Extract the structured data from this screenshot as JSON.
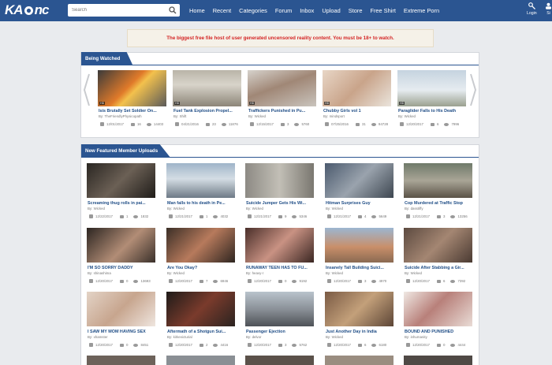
{
  "site": {
    "logo_left": "KA",
    "logo_right": "nc"
  },
  "search": {
    "placeholder": "Search"
  },
  "nav": [
    "Home",
    "Recent",
    "Categories",
    "Forum",
    "Inbox",
    "Upload",
    "Store",
    "Free Shirt",
    "Extreme Porn"
  ],
  "account": {
    "login_label": "Login",
    "signup_label": "Si"
  },
  "warning": "The biggest free file host of user generated uncensored reality content. You must be 18+ to watch.",
  "being_watched": {
    "heading": "Being Watched",
    "items": [
      {
        "title": "Isis Brutally Set Soldier On...",
        "by": "By: TheFriendlyPhysicopath",
        "date": "12/01/2017",
        "comments": "16",
        "views": "14403",
        "hd": "HD"
      },
      {
        "title": "Fuel Tank Explosion Propel...",
        "by": "By: Shift",
        "date": "04/21/2016",
        "comments": "23",
        "views": "11876",
        "hd": "HD"
      },
      {
        "title": "Traffickers Punished in Pu...",
        "by": "By: Wicked",
        "date": "12/15/2017",
        "comments": "3",
        "views": "5760",
        "hd": "HD"
      },
      {
        "title": "Chubby Girls vol 1",
        "by": "By: mindsport",
        "date": "07/25/2016",
        "comments": "31",
        "views": "94728",
        "hd": "HD"
      },
      {
        "title": "Paraglider Falls to His Death",
        "by": "By: Wicked",
        "date": "12/20/2017",
        "comments": "6",
        "views": "7996",
        "hd": "HD"
      }
    ]
  },
  "featured": {
    "heading": "New Featured Member Uploads",
    "items": [
      {
        "title": "Screaming thug rolls in pai...",
        "by": "By: Wicked",
        "date": "12/22/2017",
        "comments": "1",
        "views": "1832"
      },
      {
        "title": "Man falls to his death in Pe...",
        "by": "By: Wicked",
        "date": "12/21/2017",
        "comments": "1",
        "views": "4032"
      },
      {
        "title": "Suicide Jumper Gets His Wi...",
        "by": "By: Wicked",
        "date": "12/21/2017",
        "comments": "9",
        "views": "5346"
      },
      {
        "title": "Hitman Surprises Guy",
        "by": "By: Wicked",
        "date": "12/21/2017",
        "comments": "4",
        "views": "5649"
      },
      {
        "title": "Cop Murdered at Traffic Stop",
        "by": "By: dasstiffy",
        "date": "12/21/2017",
        "comments": "3",
        "views": "13256"
      },
      {
        "title": "I'M SO SORRY DADDY",
        "by": "By: shinashima",
        "date": "12/20/2017",
        "comments": "0",
        "views": "13693"
      },
      {
        "title": "Are You Okay?",
        "by": "By: Wicked",
        "date": "12/20/2017",
        "comments": "7",
        "views": "6946"
      },
      {
        "title": "RUNAWAY TEEN HAS TO FU...",
        "by": "By: heavy-r",
        "date": "12/20/2017",
        "comments": "0",
        "views": "9192"
      },
      {
        "title": "Insanely Tall Building Suici...",
        "by": "By: Wicked",
        "date": "12/20/2017",
        "comments": "3",
        "views": "4970"
      },
      {
        "title": "Suicide After Stabbing a Gir...",
        "by": "By: Wicked",
        "date": "12/20/2017",
        "comments": "6",
        "views": "7392"
      },
      {
        "title": "I SAW MY MOM HAVING SEX",
        "by": "By: xhamster",
        "date": "12/20/2017",
        "comments": "0",
        "views": "8451"
      },
      {
        "title": "Aftermath of a Shotgun Sui...",
        "by": "By: kirkevicturial",
        "date": "12/20/2017",
        "comments": "2",
        "views": "4416"
      },
      {
        "title": "Passenger Ejection",
        "by": "By: delvor",
        "date": "12/20/2017",
        "comments": "3",
        "views": "5762"
      },
      {
        "title": "Just Another Day in India",
        "by": "By: Wicked",
        "date": "12/20/2017",
        "comments": "6",
        "views": "6180"
      },
      {
        "title": "BOUND AND PUNISHED",
        "by": "By: inhumanity",
        "date": "12/20/2017",
        "comments": "0",
        "views": "4444"
      }
    ]
  },
  "colors": {
    "nav_bg": "#2b5591",
    "link": "#1f4d86",
    "warning_text": "#d42424",
    "page_bg": "#e9ebee"
  },
  "icons": [
    "search-icon",
    "login-icon",
    "signup-icon",
    "arrow-left-icon",
    "arrow-right-icon",
    "calendar-icon",
    "comment-icon",
    "eye-icon"
  ]
}
